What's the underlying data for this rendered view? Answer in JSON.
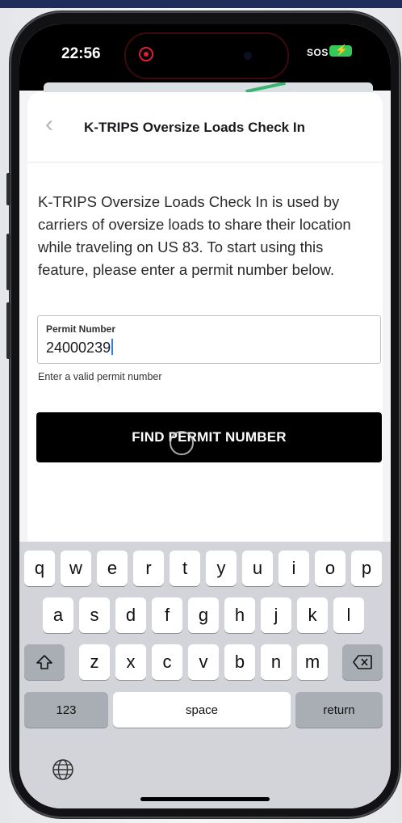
{
  "status": {
    "time": "22:56",
    "sos": "SOS",
    "battery_icon": "battery-charging-icon"
  },
  "nav": {
    "title": "K-TRIPS Oversize Loads Check In",
    "back_icon": "chevron-left-icon"
  },
  "description": "K-TRIPS Oversize Loads Check In is used by carriers of oversize loads to share their location while traveling on US 83. To start using this feature, please enter a permit number below.",
  "permit_field": {
    "label": "Permit Number",
    "value": "24000239"
  },
  "helper_text": "Enter a valid permit number",
  "find_button": "FIND PERMIT NUMBER",
  "keyboard": {
    "row1": [
      "q",
      "w",
      "e",
      "r",
      "t",
      "y",
      "u",
      "i",
      "o",
      "p"
    ],
    "row2": [
      "a",
      "s",
      "d",
      "f",
      "g",
      "h",
      "j",
      "k",
      "l"
    ],
    "row3": [
      "z",
      "x",
      "c",
      "v",
      "b",
      "n",
      "m"
    ],
    "numbers": "123",
    "space": "space",
    "return": "return"
  },
  "colors": {
    "button_bg": "#000000",
    "caret": "#2b7cff",
    "battery": "#34c759"
  }
}
